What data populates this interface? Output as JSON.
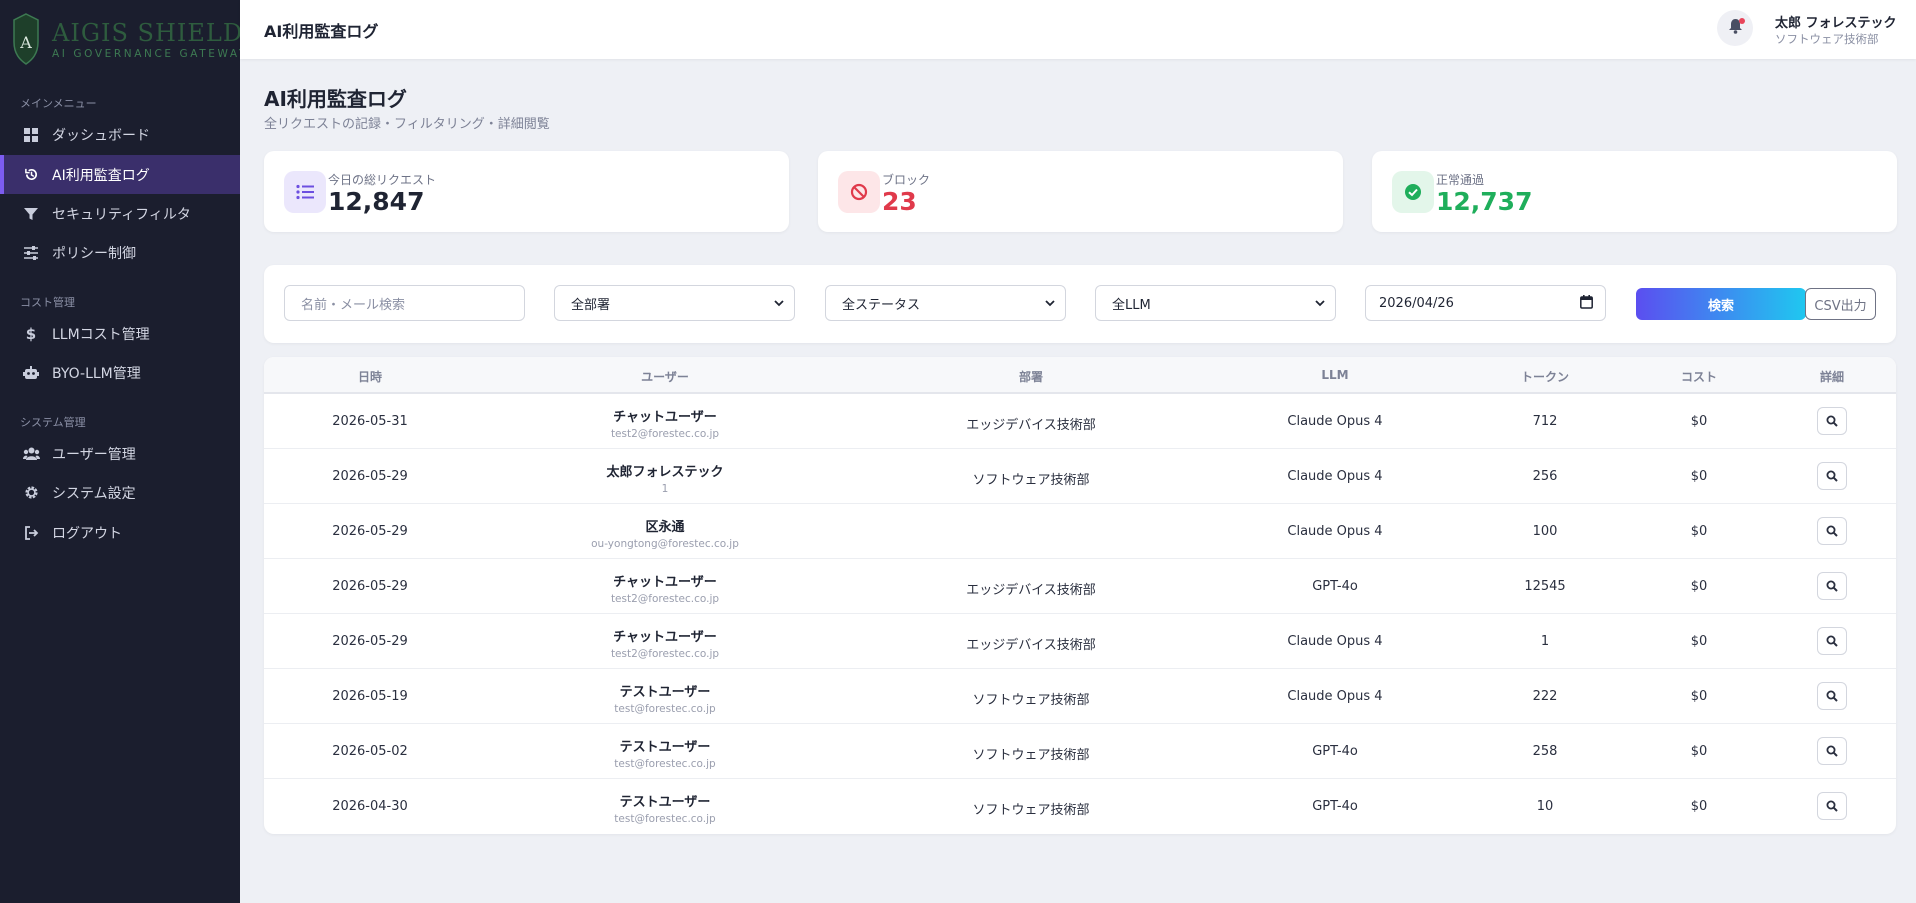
{
  "brand": {
    "title": "AIGIS SHIELD",
    "subtitle": "AI GOVERNANCE GATEWAY",
    "shield_letter": "A",
    "color": "#2e5c3e"
  },
  "sidebar": {
    "sections": {
      "main": "メインメニュー",
      "cost": "コスト管理",
      "system": "システム管理"
    },
    "items": [
      {
        "label": "ダッシュボード",
        "icon": "grid-icon",
        "active": false
      },
      {
        "label": "AI利用監査ログ",
        "icon": "history-icon",
        "active": true
      },
      {
        "label": "セキュリティフィルタ",
        "icon": "filter-icon",
        "active": false
      },
      {
        "label": "ポリシー制御",
        "icon": "sliders-icon",
        "active": false
      },
      {
        "label": "LLMコスト管理",
        "icon": "dollar-icon",
        "active": false
      },
      {
        "label": "BYO-LLM管理",
        "icon": "robot-icon",
        "active": false
      },
      {
        "label": "ユーザー管理",
        "icon": "users-icon",
        "active": false
      },
      {
        "label": "システム設定",
        "icon": "gear-icon",
        "active": false
      },
      {
        "label": "ログアウト",
        "icon": "logout-icon",
        "active": false
      }
    ]
  },
  "header": {
    "title": "AI利用監査ログ",
    "user_name": "太郎 フォレステック",
    "user_dept": "ソフトウェア技術部"
  },
  "page": {
    "title": "AI利用監査ログ",
    "subtitle": "全リクエストの記録・フィルタリング・詳細閲覧"
  },
  "stats": [
    {
      "label": "今日の総リクエスト",
      "value": "12,847",
      "icon": "list-icon",
      "color": "#1f2433",
      "icon_bg": "#ebe7fc",
      "icon_color": "#6c4fe0"
    },
    {
      "label": "ブロック",
      "value": "23",
      "icon": "ban-icon",
      "color": "#e03a4b",
      "icon_bg": "#fde6e8",
      "icon_color": "#e03a4b"
    },
    {
      "label": "正常通過",
      "value": "12,737",
      "icon": "check-circle-icon",
      "color": "#1fae5b",
      "icon_bg": "#e3f6ea",
      "icon_color": "#1fae5b"
    }
  ],
  "filters": {
    "search_placeholder": "名前・メール検索",
    "department": "全部署",
    "status": "全ステータス",
    "llm": "全LLM",
    "date": "2026/04/26",
    "search_button": "検索",
    "csv_button": "CSV出力"
  },
  "table": {
    "columns": [
      "日時",
      "ユーザー",
      "部署",
      "LLM",
      "トークン",
      "コスト",
      "詳細"
    ],
    "rows": [
      {
        "date": "2026-05-31",
        "user": "チャットユーザー",
        "email": "test2@forestec.co.jp",
        "dept": "エッジデバイス技術部",
        "llm": "Claude Opus 4",
        "tokens": "712",
        "cost": "$0"
      },
      {
        "date": "2026-05-29",
        "user": "太郎フォレステック",
        "email": "1",
        "dept": "ソフトウェア技術部",
        "llm": "Claude Opus 4",
        "tokens": "256",
        "cost": "$0"
      },
      {
        "date": "2026-05-29",
        "user": "区永通",
        "email": "ou-yongtong@forestec.co.jp",
        "dept": "",
        "llm": "Claude Opus 4",
        "tokens": "100",
        "cost": "$0"
      },
      {
        "date": "2026-05-29",
        "user": "チャットユーザー",
        "email": "test2@forestec.co.jp",
        "dept": "エッジデバイス技術部",
        "llm": "GPT-4o",
        "tokens": "12545",
        "cost": "$0"
      },
      {
        "date": "2026-05-29",
        "user": "チャットユーザー",
        "email": "test2@forestec.co.jp",
        "dept": "エッジデバイス技術部",
        "llm": "Claude Opus 4",
        "tokens": "1",
        "cost": "$0"
      },
      {
        "date": "2026-05-19",
        "user": "テストユーザー",
        "email": "test@forestec.co.jp",
        "dept": "ソフトウェア技術部",
        "llm": "Claude Opus 4",
        "tokens": "222",
        "cost": "$0"
      },
      {
        "date": "2026-05-02",
        "user": "テストユーザー",
        "email": "test@forestec.co.jp",
        "dept": "ソフトウェア技術部",
        "llm": "GPT-4o",
        "tokens": "258",
        "cost": "$0"
      },
      {
        "date": "2026-04-30",
        "user": "テストユーザー",
        "email": "test@forestec.co.jp",
        "dept": "ソフトウェア技術部",
        "llm": "GPT-4o",
        "tokens": "10",
        "cost": "$0"
      }
    ]
  }
}
